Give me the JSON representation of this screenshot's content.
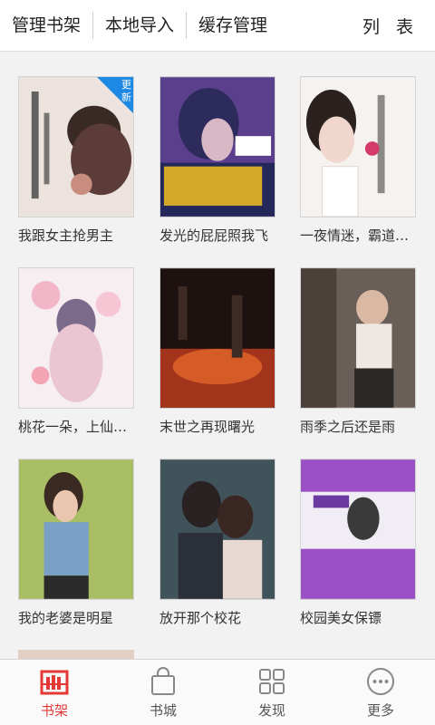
{
  "topbar": {
    "tabs": [
      "管理书架",
      "本地导入",
      "缓存管理"
    ],
    "right_label": "列 表"
  },
  "badge": {
    "line1": "更",
    "line2": "新"
  },
  "books": [
    {
      "title": "我跟女主抢男主",
      "cover_color": "#e8ddd8"
    },
    {
      "title": "发光的屁屁照我飞",
      "cover_color": "#5a3f8c"
    },
    {
      "title": "一夜情迷，霸道总裁恋上...",
      "cover_color": "#f4f0ef"
    },
    {
      "title": "桃花一朵，上仙请负责",
      "cover_color": "#f4e9ee"
    },
    {
      "title": "末世之再现曙光",
      "cover_color": "#3a1e16"
    },
    {
      "title": "雨季之后还是雨",
      "cover_color": "#5c5450"
    },
    {
      "title": "我的老婆是明星",
      "cover_color": "#9fb25a"
    },
    {
      "title": "放开那个校花",
      "cover_color": "#3b4a50"
    },
    {
      "title": "校园美女保镖",
      "cover_color": "#9a4fc4"
    }
  ],
  "bottom_nav": {
    "items": [
      {
        "label": "书架",
        "icon": "bookshelf-icon",
        "active": true
      },
      {
        "label": "书城",
        "icon": "shopping-bag-icon",
        "active": false
      },
      {
        "label": "发现",
        "icon": "grid-icon",
        "active": false
      },
      {
        "label": "更多",
        "icon": "more-dots-icon",
        "active": false
      }
    ]
  },
  "colors": {
    "accent": "#e53935",
    "badge": "#1e88e5",
    "purple_cover": "#9a4fc4"
  }
}
